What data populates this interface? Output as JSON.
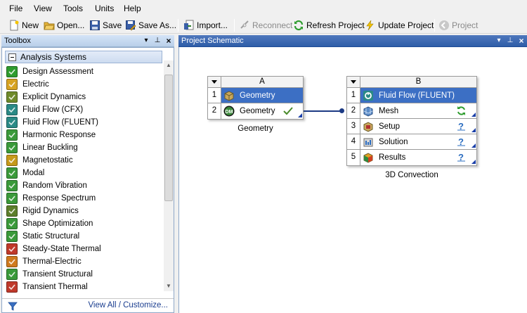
{
  "menubar": {
    "items": [
      "File",
      "View",
      "Tools",
      "Units",
      "Help"
    ]
  },
  "toolbar": {
    "new": "New",
    "open": "Open...",
    "save": "Save",
    "save_as": "Save As...",
    "import": "Import...",
    "reconnect": "Reconnect",
    "refresh": "Refresh Project",
    "update": "Update Project",
    "project": "Project"
  },
  "toolbox": {
    "title": "Toolbox",
    "group": "Analysis Systems",
    "items": [
      {
        "label": "Design Assessment",
        "icon": "design-assessment-icon",
        "color": "#2e9c2e"
      },
      {
        "label": "Electric",
        "icon": "electric-icon",
        "color": "#d7a321"
      },
      {
        "label": "Explicit Dynamics",
        "icon": "explicit-dynamics-icon",
        "color": "#6f8a2b"
      },
      {
        "label": "Fluid Flow (CFX)",
        "icon": "fluid-flow-cfx-icon",
        "color": "#2a8a86"
      },
      {
        "label": "Fluid Flow (FLUENT)",
        "icon": "fluid-flow-fluent-icon",
        "color": "#2a8a86"
      },
      {
        "label": "Harmonic Response",
        "icon": "harmonic-response-icon",
        "color": "#3a9a3a"
      },
      {
        "label": "Linear Buckling",
        "icon": "linear-buckling-icon",
        "color": "#3a9a3a"
      },
      {
        "label": "Magnetostatic",
        "icon": "magnetostatic-icon",
        "color": "#c79a1b"
      },
      {
        "label": "Modal",
        "icon": "modal-icon",
        "color": "#3a9a3a"
      },
      {
        "label": "Random Vibration",
        "icon": "random-vibration-icon",
        "color": "#3a9a3a"
      },
      {
        "label": "Response Spectrum",
        "icon": "response-spectrum-icon",
        "color": "#3a9a3a"
      },
      {
        "label": "Rigid Dynamics",
        "icon": "rigid-dynamics-icon",
        "color": "#5d7f2c"
      },
      {
        "label": "Shape Optimization",
        "icon": "shape-optimization-icon",
        "color": "#3a9a3a"
      },
      {
        "label": "Static Structural",
        "icon": "static-structural-icon",
        "color": "#3a9a3a"
      },
      {
        "label": "Steady-State Thermal",
        "icon": "steady-state-thermal-icon",
        "color": "#c0392b"
      },
      {
        "label": "Thermal-Electric",
        "icon": "thermal-electric-icon",
        "color": "#d07a1e"
      },
      {
        "label": "Transient Structural",
        "icon": "transient-structural-icon",
        "color": "#3a9a3a"
      },
      {
        "label": "Transient Thermal",
        "icon": "transient-thermal-icon",
        "color": "#c0392b"
      }
    ],
    "footer": "View All / Customize..."
  },
  "schematic": {
    "title": "Project Schematic",
    "system_a": {
      "letter": "A",
      "caption": "Geometry",
      "cells": [
        {
          "num": "1",
          "label": "Geometry",
          "icon": "geometry-system-icon"
        },
        {
          "num": "2",
          "label": "Geometry",
          "icon": "designmodeler-icon",
          "state": "up-to-date-check-icon"
        }
      ]
    },
    "system_b": {
      "letter": "B",
      "caption": "3D Convection",
      "cells": [
        {
          "num": "1",
          "label": "Fluid Flow (FLUENT)",
          "icon": "fluent-icon"
        },
        {
          "num": "2",
          "label": "Mesh",
          "icon": "mesh-icon",
          "state": "refresh-required-icon"
        },
        {
          "num": "3",
          "label": "Setup",
          "icon": "setup-icon",
          "state": "unfulfilled-icon"
        },
        {
          "num": "4",
          "label": "Solution",
          "icon": "solution-icon",
          "state": "unfulfilled-icon"
        },
        {
          "num": "5",
          "label": "Results",
          "icon": "results-icon",
          "state": "unfulfilled-icon"
        }
      ]
    }
  }
}
